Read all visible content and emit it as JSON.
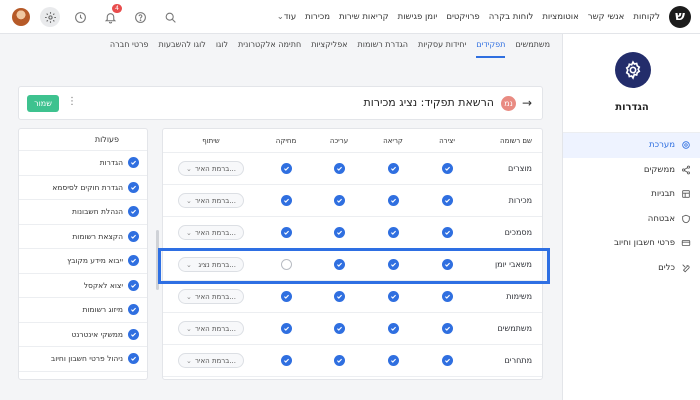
{
  "topnav": {
    "logo": "ש",
    "items": [
      "לקוחות",
      "אנשי קשר",
      "אוטומציות",
      "לוחות בקרה",
      "פרויקטים",
      "יומן פגישות",
      "קריאות שירות",
      "מכירות",
      "עוד"
    ],
    "notification_count": "4"
  },
  "sidebar": {
    "title": "הגדרות",
    "items": [
      {
        "label": "מערכת",
        "icon": "gear-icon",
        "active": true
      },
      {
        "label": "ממשקים",
        "icon": "share-icon",
        "active": false
      },
      {
        "label": "תבניות",
        "icon": "template-icon",
        "active": false
      },
      {
        "label": "אבטחה",
        "icon": "shield-icon",
        "active": false
      },
      {
        "label": "פרטי חשבון וחיוב",
        "icon": "card-icon",
        "active": false
      },
      {
        "label": "כלים",
        "icon": "tools-icon",
        "active": false
      }
    ]
  },
  "tabs": [
    {
      "label": "משתמשים",
      "active": false
    },
    {
      "label": "תפקידים",
      "active": true
    },
    {
      "label": "יחידות עסקיות",
      "active": false
    },
    {
      "label": "הגדרת רשומות",
      "active": false
    },
    {
      "label": "אפליקציות",
      "active": false
    },
    {
      "label": "חתימה אלקטרונית",
      "active": false
    },
    {
      "label": "לוגו",
      "active": false
    },
    {
      "label": "לוגו להשבעות",
      "active": false
    },
    {
      "label": "פרטי חברה",
      "active": false
    }
  ],
  "header": {
    "title": "הרשאת תפקיד: נציג מכירות",
    "role_initial": "נמ",
    "save_label": "שמור"
  },
  "actions_panel": {
    "heading": "פעולות",
    "items": [
      "הגדרות",
      "הגדרת חוקים לסיסמא",
      "הנהלת חשבונות",
      "הקצאת רשומות",
      "ייבוא מידע מקובץ",
      "יצוא לאקסל",
      "מיזוג רשומות",
      "ממשקי אינטרנט",
      "ניהול פרטי חשבון וחיוב"
    ]
  },
  "permissions": {
    "columns": {
      "name": "שם רשומה",
      "create": "יצירה",
      "read": "קריאה",
      "edit": "עריכה",
      "delete": "מחיקה",
      "share": "שיתוף"
    },
    "rows": [
      {
        "name": "מוצרים",
        "create": true,
        "read": true,
        "edit": true,
        "delete": true,
        "share": "ברמת האיר..."
      },
      {
        "name": "מכירות",
        "create": true,
        "read": true,
        "edit": true,
        "delete": true,
        "share": "ברמת האיר..."
      },
      {
        "name": "מסמכים",
        "create": true,
        "read": true,
        "edit": true,
        "delete": true,
        "share": "ברמת האיר..."
      },
      {
        "name": "משאבי יומן",
        "create": true,
        "read": true,
        "edit": true,
        "delete": false,
        "share": "ברמת נציג..."
      },
      {
        "name": "משימות",
        "create": true,
        "read": true,
        "edit": true,
        "delete": true,
        "share": "ברמת האיר..."
      },
      {
        "name": "משתמשים",
        "create": true,
        "read": true,
        "edit": true,
        "delete": true,
        "share": "ברמת האיר..."
      },
      {
        "name": "מתחרים",
        "create": true,
        "read": true,
        "edit": true,
        "delete": true,
        "share": "ברמת האיר..."
      }
    ],
    "highlighted_row": "משאבי יומן"
  },
  "colors": {
    "accent": "#2f6fe0",
    "save": "#3ec28f",
    "highlight": "#2e6fe3",
    "sidebar_icon_bg": "#232d6b"
  }
}
